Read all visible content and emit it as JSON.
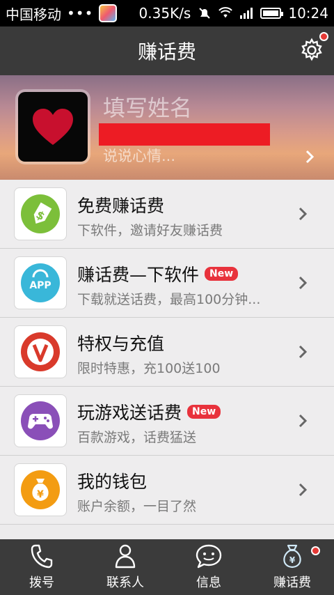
{
  "status_bar": {
    "carrier": "中国移动",
    "dots": "•••",
    "speed": "0.35K/s",
    "time": "10:24"
  },
  "title_bar": {
    "title": "赚话费"
  },
  "profile": {
    "name_placeholder": "填写姓名",
    "mood_placeholder": "说说心情..."
  },
  "menu_items": [
    {
      "title": "免费赚话费",
      "subtitle": "下软件，邀请好友赚话费",
      "icon": "price-tag-icon",
      "badge": ""
    },
    {
      "title": "赚话费—下软件",
      "subtitle": "下载就送话费，最高100分钟...",
      "icon": "app-store-icon",
      "badge": "New"
    },
    {
      "title": "特权与充值",
      "subtitle": "限时特惠，充100送100",
      "icon": "vip-icon",
      "badge": ""
    },
    {
      "title": "玩游戏送话费",
      "subtitle": "百款游戏，话费猛送",
      "icon": "gamepad-icon",
      "badge": "New"
    },
    {
      "title": "我的钱包",
      "subtitle": "账户余额，一目了然",
      "icon": "money-bag-icon",
      "badge": ""
    }
  ],
  "bottom_nav": [
    {
      "label": "拨号",
      "icon": "phone-icon"
    },
    {
      "label": "联系人",
      "icon": "contacts-icon"
    },
    {
      "label": "信息",
      "icon": "message-icon"
    },
    {
      "label": "赚话费",
      "icon": "money-bag-icon"
    }
  ],
  "colors": {
    "accent_red": "#e8323c",
    "title_bar": "#3a3a3a",
    "nav_bar": "#3b3b3b"
  }
}
